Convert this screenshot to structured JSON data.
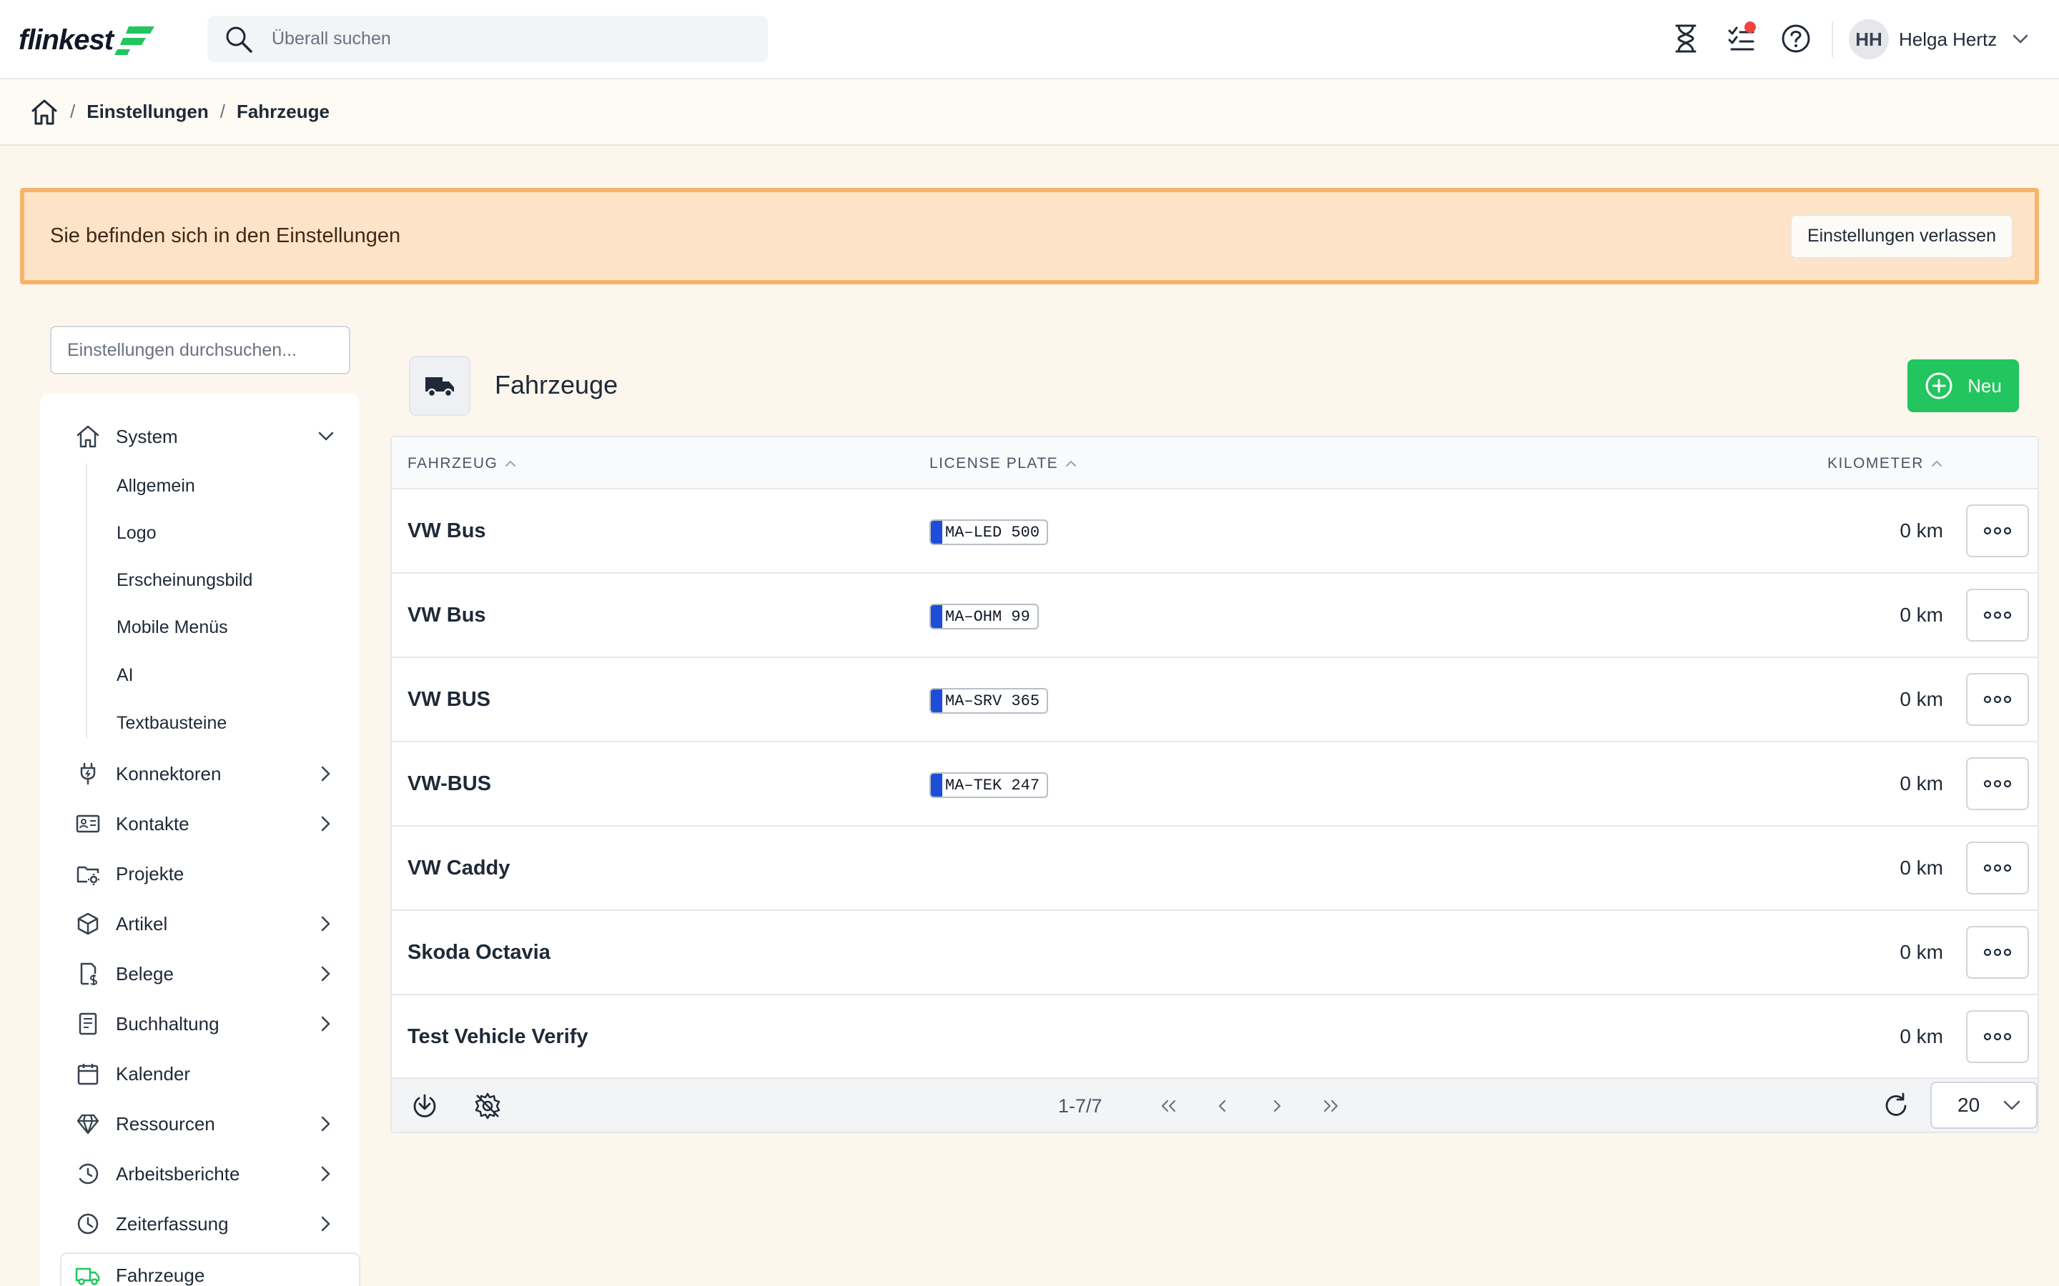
{
  "app": {
    "logo_text": "flinkest",
    "brand_color": "#22c55e"
  },
  "topbar": {
    "search_placeholder": "Überall suchen",
    "icons": [
      "hourglass-icon",
      "checklist-icon",
      "help-icon"
    ],
    "user": {
      "initials": "HH",
      "name": "Helga Hertz"
    }
  },
  "breadcrumb": {
    "items": [
      "Einstellungen",
      "Fahrzeuge"
    ],
    "separator": "/"
  },
  "banner": {
    "text": "Sie befinden sich in den Einstellungen",
    "button": "Einstellungen verlassen"
  },
  "sidebar": {
    "search_placeholder": "Einstellungen durchsuchen...",
    "items": [
      {
        "label": "System",
        "icon": "home-icon",
        "expanded": true
      },
      {
        "label": "Konnektoren",
        "icon": "plug-icon"
      },
      {
        "label": "Kontakte",
        "icon": "contact-card-icon"
      },
      {
        "label": "Projekte",
        "icon": "folder-gear-icon"
      },
      {
        "label": "Artikel",
        "icon": "box-icon"
      },
      {
        "label": "Belege",
        "icon": "receipt-icon"
      },
      {
        "label": "Buchhaltung",
        "icon": "ledger-icon"
      },
      {
        "label": "Kalender",
        "icon": "calendar-icon"
      },
      {
        "label": "Ressourcen",
        "icon": "diamond-icon"
      },
      {
        "label": "Arbeitsberichte",
        "icon": "clock-icon"
      },
      {
        "label": "Zeiterfassung",
        "icon": "clock-history-icon"
      },
      {
        "label": "Fahrzeuge",
        "icon": "truck-icon",
        "active": true
      }
    ],
    "system_subitems": [
      "Allgemein",
      "Logo",
      "Erscheinungsbild",
      "Mobile Menüs",
      "AI",
      "Textbausteine"
    ]
  },
  "main": {
    "title": "Fahrzeuge",
    "new_button": "Neu",
    "columns": [
      "FAHRZEUG",
      "LICENSE PLATE",
      "KILOMETER"
    ],
    "rows": [
      {
        "name": "VW Bus",
        "plate": "MA–LED 500",
        "km": "0 km"
      },
      {
        "name": "VW Bus",
        "plate": "MA–OHM 99",
        "km": "0 km"
      },
      {
        "name": "VW BUS",
        "plate": "MA–SRV 365",
        "km": "0 km"
      },
      {
        "name": "VW-BUS",
        "plate": "MA–TEK 247",
        "km": "0 km"
      },
      {
        "name": "VW Caddy",
        "plate": "",
        "km": "0 km"
      },
      {
        "name": "Skoda Octavia",
        "plate": "",
        "km": "0 km"
      },
      {
        "name": "Test Vehicle Verify",
        "plate": "",
        "km": "0 km"
      }
    ],
    "pagination": {
      "range": "1-7/7",
      "per_page": "20"
    }
  }
}
